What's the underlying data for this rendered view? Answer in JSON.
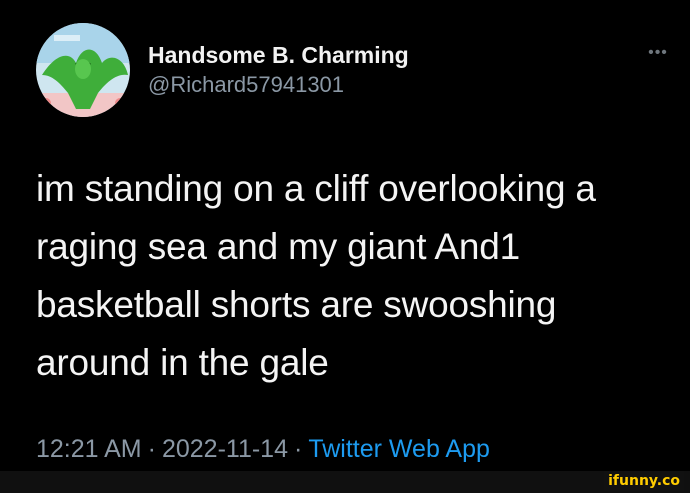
{
  "author": {
    "display_name": "Handsome B. Charming",
    "handle": "@Richard57941301"
  },
  "tweet": {
    "text_lines": [
      "im standing on a cliff overlooking a",
      "raging sea and my giant And1",
      "basketball shorts are swooshing",
      "around in the gale"
    ]
  },
  "meta": {
    "time": "12:21 AM",
    "separator": "·",
    "date": "2022-11-14",
    "source": "Twitter Web App"
  },
  "more_button": {
    "icon": "ellipsis-icon",
    "glyph": "•••"
  },
  "watermark": {
    "text": "ifunny.co"
  },
  "colors": {
    "background": "#000000",
    "text": "#e7e9ea",
    "secondary": "#8b98a5",
    "link": "#1d9bf0",
    "watermark": "#ffcc00"
  }
}
